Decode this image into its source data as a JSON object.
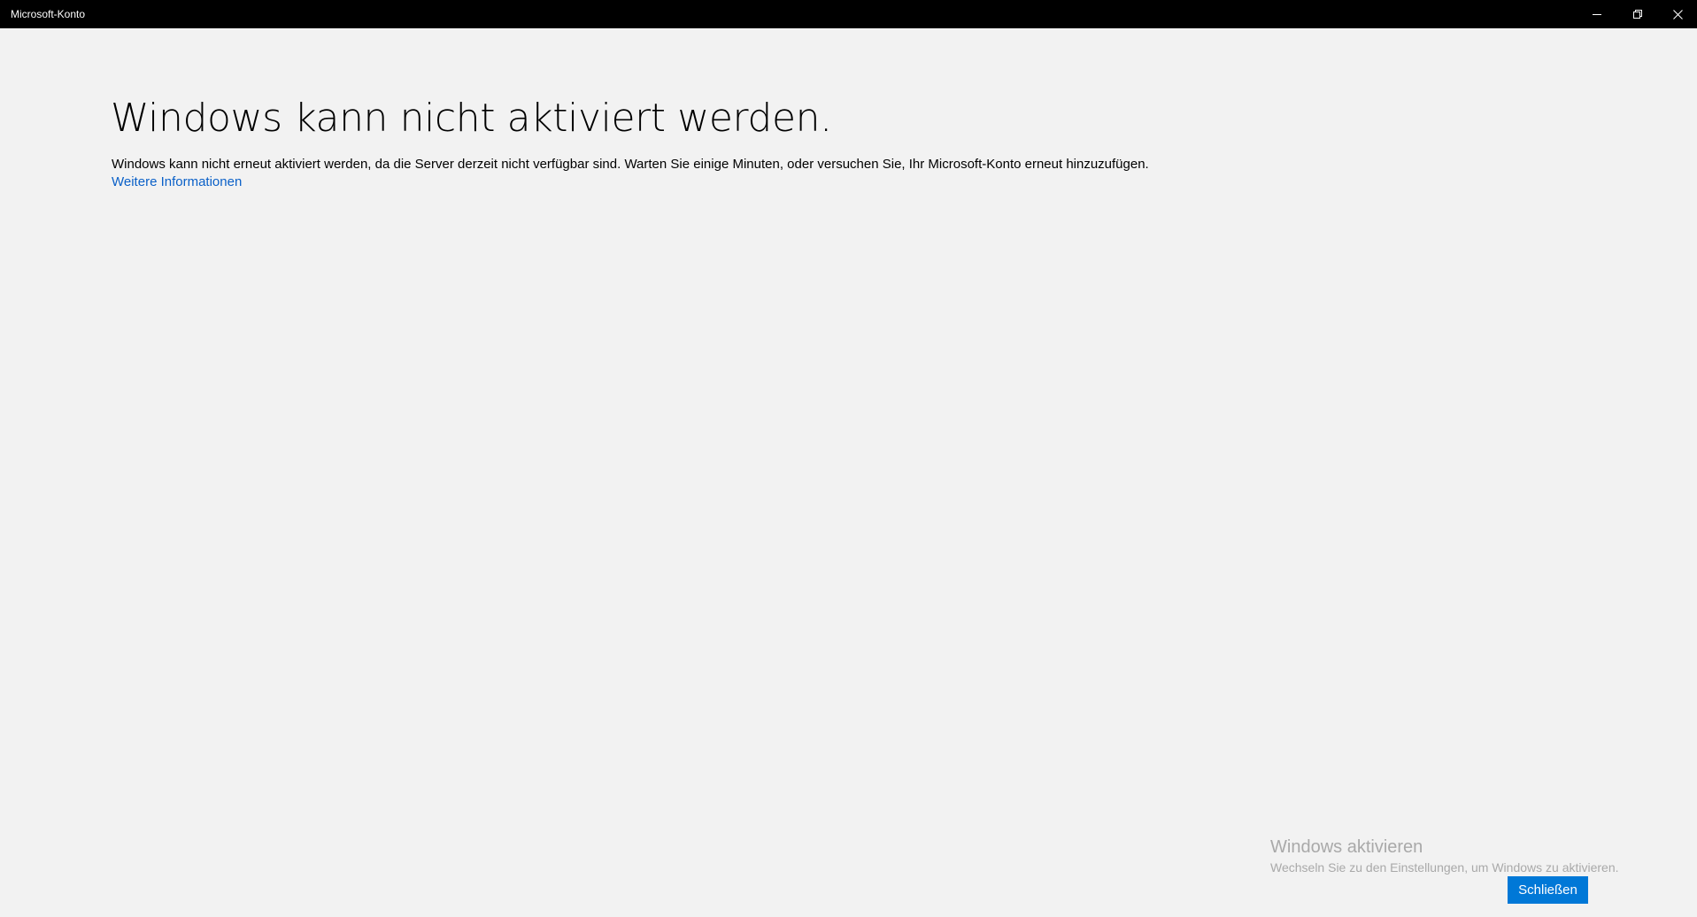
{
  "window": {
    "title": "Microsoft-Konto",
    "controls": {
      "minimize_icon": "minimize-icon",
      "restore_icon": "restore-icon",
      "close_icon": "close-icon"
    }
  },
  "main": {
    "heading": "Windows kann nicht aktiviert werden.",
    "description": "Windows kann nicht erneut aktiviert werden, da die Server derzeit nicht verfügbar sind. Warten Sie einige Minuten, oder versuchen Sie, Ihr Microsoft-Konto erneut hinzuzufügen.",
    "more_info_link": "Weitere Informationen"
  },
  "watermark": {
    "title": "Windows aktivieren",
    "subtitle": "Wechseln Sie zu den Einstellungen, um Windows zu aktivieren."
  },
  "footer": {
    "close_label": "Schließen"
  },
  "colors": {
    "titlebar_bg": "#000000",
    "page_bg": "#f2f2f2",
    "accent": "#0078d7",
    "link": "#0a60c8",
    "watermark_text": "#a9a9a9"
  }
}
